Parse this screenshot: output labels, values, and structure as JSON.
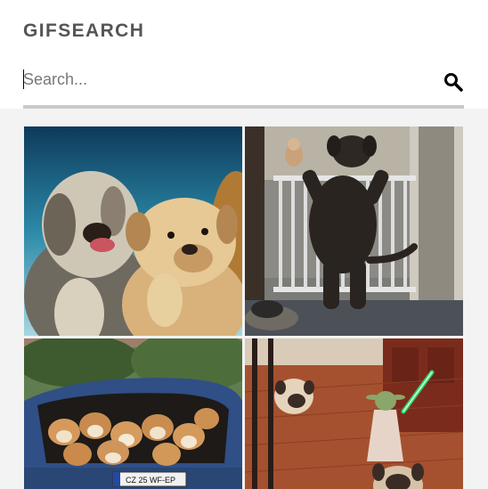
{
  "header": {
    "brand": "GIFSEARCH"
  },
  "search": {
    "placeholder": "Search...",
    "value": "",
    "icon": "search-icon"
  },
  "results": [
    {
      "subject": "bulldog-and-shaggy-dog-gif",
      "plate_text": ""
    },
    {
      "subject": "dog-at-baby-gate-gif",
      "plate_text": ""
    },
    {
      "subject": "puppies-in-car-trunk-gif",
      "plate_text": "CZ 25 WF-EP"
    },
    {
      "subject": "yoda-toy-with-pugs-gif",
      "plate_text": ""
    }
  ],
  "colors": {
    "brand_text": "#555555",
    "search_underline": "#c9c9c9",
    "content_background": "#f3f3f3"
  }
}
